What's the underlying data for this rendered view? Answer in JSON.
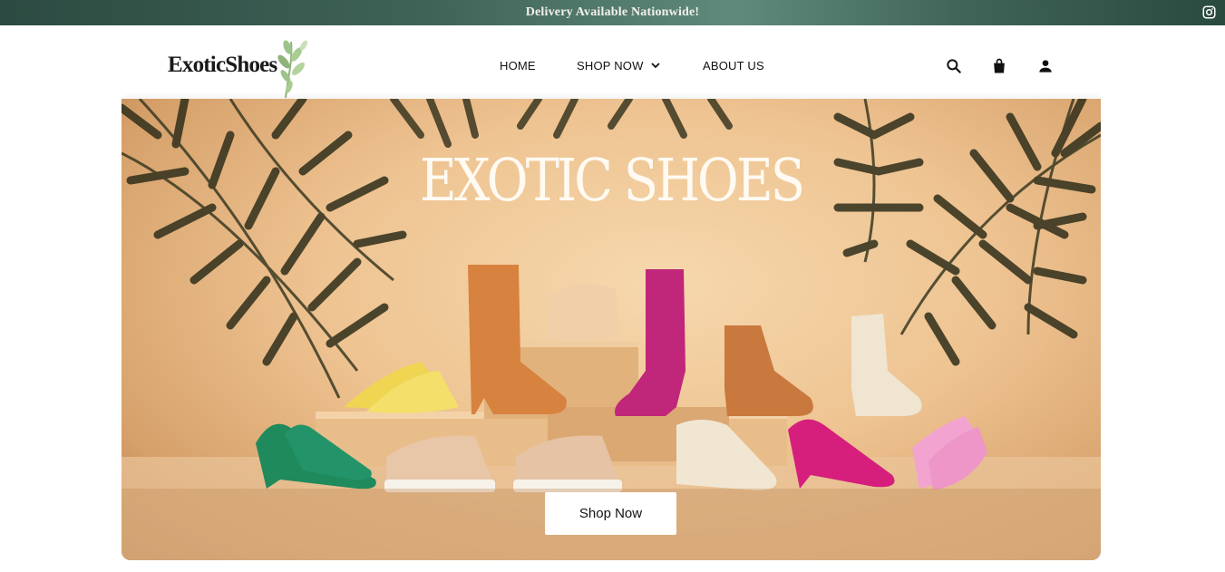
{
  "announcement": {
    "text": "Delivery Available Nationwide!"
  },
  "brand": {
    "logo_text": "ExoticShoes"
  },
  "nav": {
    "home": "HOME",
    "shop_now": "SHOP NOW",
    "about_us": "ABOUT US"
  },
  "hero": {
    "title": "EXOTIC SHOES",
    "cta_label": "Shop Now"
  },
  "icons": {
    "social": "instagram-icon",
    "search": "search-icon",
    "cart": "shopping-bag-icon",
    "account": "user-icon",
    "dropdown": "chevron-down-icon"
  },
  "colors": {
    "announcement_bg": "#3f6357",
    "hero_bg": "#eec391",
    "text": "#111111"
  }
}
